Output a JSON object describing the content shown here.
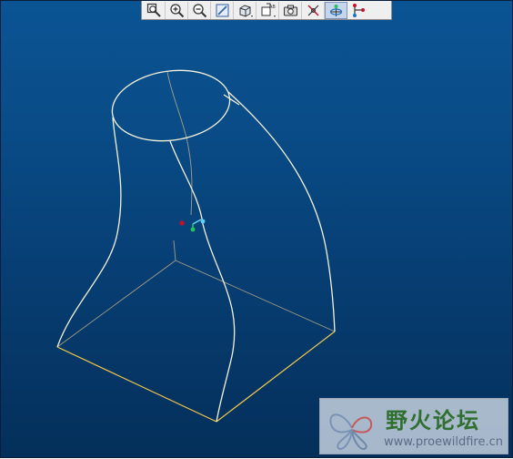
{
  "toolbar": {
    "buttons": [
      {
        "name": "zoom-window",
        "icon": "zoom-window-icon"
      },
      {
        "name": "zoom-in",
        "icon": "zoom-in-icon"
      },
      {
        "name": "zoom-out",
        "icon": "zoom-out-icon"
      },
      {
        "name": "repaint",
        "icon": "repaint-icon"
      },
      {
        "name": "display-style",
        "icon": "display-style-icon"
      },
      {
        "name": "saved-views",
        "icon": "saved-views-icon"
      },
      {
        "name": "screenshot",
        "icon": "camera-icon"
      },
      {
        "name": "datum-display",
        "icon": "datum-display-icon"
      },
      {
        "name": "spin-center",
        "icon": "spin-center-icon",
        "active": true
      },
      {
        "name": "annotation",
        "icon": "annotation-icon"
      }
    ]
  },
  "colors": {
    "background_top": "#0a5494",
    "background_bottom": "#042f5a",
    "wireframe": "#f4f1da",
    "selected_edge": "#f2c84a",
    "hidden_edge": "#9c9c88",
    "axis_x": "#c8102e",
    "axis_y": "#22c55e",
    "axis_z": "#5fd3f3"
  },
  "watermark": {
    "title": "野火论坛",
    "url": "www.proewildfire.cn"
  }
}
